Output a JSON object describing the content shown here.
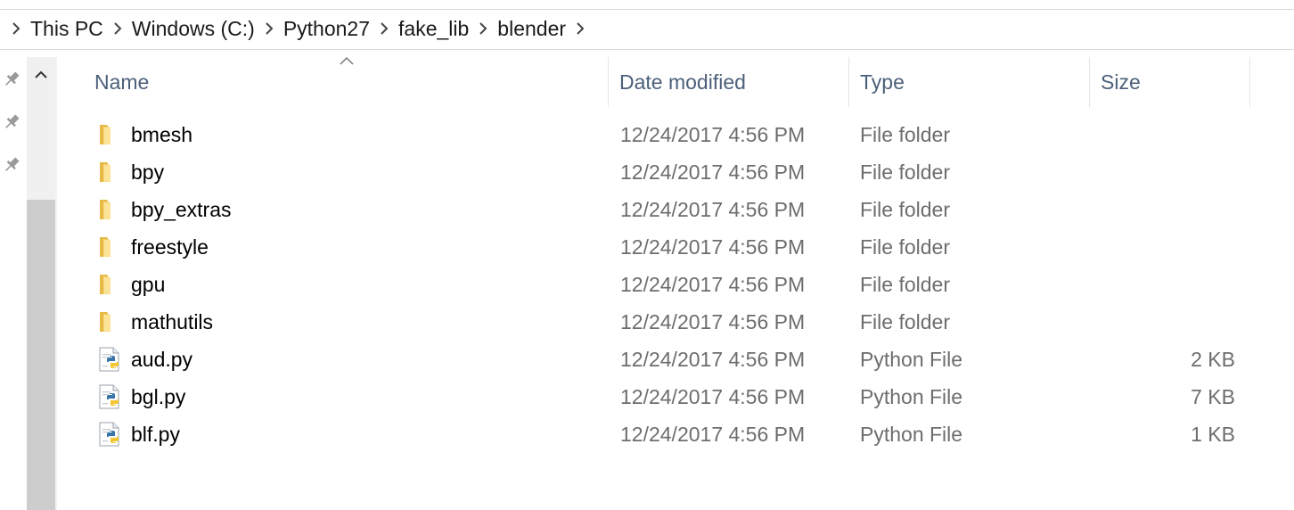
{
  "breadcrumb": [
    "This PC",
    "Windows (C:)",
    "Python27",
    "fake_lib",
    "blender"
  ],
  "columns": {
    "name": "Name",
    "date": "Date modified",
    "type": "Type",
    "size": "Size"
  },
  "sort": {
    "column": "name",
    "direction": "ascending"
  },
  "files": [
    {
      "name": "bmesh",
      "date": "12/24/2017 4:56 PM",
      "type": "File folder",
      "size": "",
      "icon": "folder-icon"
    },
    {
      "name": "bpy",
      "date": "12/24/2017 4:56 PM",
      "type": "File folder",
      "size": "",
      "icon": "folder-icon"
    },
    {
      "name": "bpy_extras",
      "date": "12/24/2017 4:56 PM",
      "type": "File folder",
      "size": "",
      "icon": "folder-icon"
    },
    {
      "name": "freestyle",
      "date": "12/24/2017 4:56 PM",
      "type": "File folder",
      "size": "",
      "icon": "folder-icon"
    },
    {
      "name": "gpu",
      "date": "12/24/2017 4:56 PM",
      "type": "File folder",
      "size": "",
      "icon": "folder-icon"
    },
    {
      "name": "mathutils",
      "date": "12/24/2017 4:56 PM",
      "type": "File folder",
      "size": "",
      "icon": "folder-icon"
    },
    {
      "name": "aud.py",
      "date": "12/24/2017 4:56 PM",
      "type": "Python File",
      "size": "2 KB",
      "icon": "python-file-icon"
    },
    {
      "name": "bgl.py",
      "date": "12/24/2017 4:56 PM",
      "type": "Python File",
      "size": "7 KB",
      "icon": "python-file-icon"
    },
    {
      "name": "blf.py",
      "date": "12/24/2017 4:56 PM",
      "type": "Python File",
      "size": "1 KB",
      "icon": "python-file-icon"
    }
  ],
  "colors": {
    "header_text": "#4c607a",
    "secondary_text": "#6d6d6d",
    "folder": "#f8d775",
    "folder_dark": "#e7b949"
  }
}
